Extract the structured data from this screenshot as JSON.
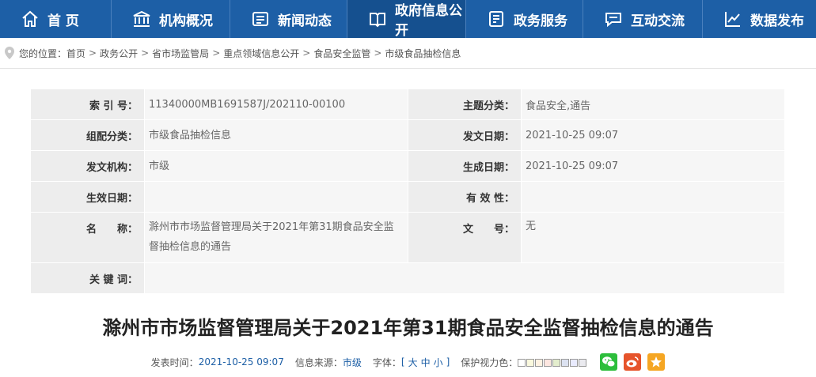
{
  "nav": {
    "items": [
      {
        "label": "首 页",
        "icon": "home-icon"
      },
      {
        "label": "机构概况",
        "icon": "institution-icon"
      },
      {
        "label": "新闻动态",
        "icon": "news-icon"
      },
      {
        "label": "政府信息公开",
        "icon": "open-info-icon",
        "active": true
      },
      {
        "label": "政务服务",
        "icon": "service-icon"
      },
      {
        "label": "互动交流",
        "icon": "chat-icon"
      },
      {
        "label": "数据发布",
        "icon": "chart-icon"
      }
    ]
  },
  "breadcrumb": {
    "prefix": "您的位置：",
    "items": [
      "首页",
      "政务公开",
      "省市场监管局",
      "重点领域信息公开",
      "食品安全监管",
      "市级食品抽检信息"
    ],
    "separator": ">"
  },
  "meta": {
    "index_label": "索 引 号：",
    "index_value": "11340000MB1691587J/202110-00100",
    "topic_label": "主题分类：",
    "topic_value": "食品安全,通告",
    "group_label": "组配分类：",
    "group_value": "市级食品抽检信息",
    "pubdate_label": "发文日期：",
    "pubdate_value": "2021-10-25 09:07",
    "org_label": "发文机构：",
    "org_value": "市级",
    "gendate_label": "生成日期：",
    "gendate_value": "2021-10-25 09:07",
    "effdate_label": "生效日期：",
    "effdate_value": "",
    "validity_label": "有 效 性：",
    "validity_value": "",
    "name_label": "名　　称：",
    "name_value": "滁州市市场监督管理局关于2021年第31期食品安全监督抽检信息的通告",
    "docno_label": "文　　号：",
    "docno_value": "无",
    "keyword_label": "关 键 词：",
    "keyword_value": ""
  },
  "article": {
    "title": "滁州市市场监督管理局关于2021年第31期食品安全监督抽检信息的通告",
    "time_label": "发表时间：",
    "time_value": "2021-10-25 09:07",
    "source_label": "信息来源：",
    "source_value": "市级",
    "font_label": "字体：",
    "font_open": "[",
    "font_large": "大",
    "font_medium": "中",
    "font_small": "小",
    "font_close": "]",
    "eye_label": "保护视力色：",
    "eye_colors": [
      "#ffffff",
      "#faf9de",
      "#fff2e2",
      "#fde6e0",
      "#e3edcd",
      "#dce2f1",
      "#e9ebfe",
      "#eaeaef"
    ]
  },
  "colors": {
    "nav_bg": "#1d5fa6",
    "wechat": "#2dbe3c",
    "weibo": "#e6542b",
    "favorite": "#f5a623"
  }
}
